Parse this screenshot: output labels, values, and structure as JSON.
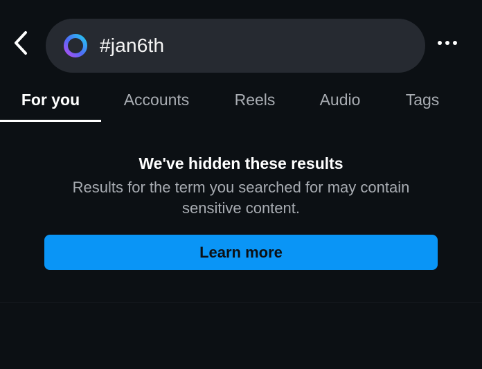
{
  "header": {
    "back_icon": "chevron-left-icon",
    "search": {
      "query": "#jan6th",
      "icon": "meta-ai-ring-icon"
    },
    "more_icon": "more-horizontal-icon"
  },
  "tabs": [
    {
      "label": "For you",
      "active": true
    },
    {
      "label": "Accounts",
      "active": false
    },
    {
      "label": "Reels",
      "active": false
    },
    {
      "label": "Audio",
      "active": false
    },
    {
      "label": "Tags",
      "active": false
    }
  ],
  "notice": {
    "title": "We've hidden these results",
    "body": "Results for the term you searched for may contain sensitive content.",
    "button_label": "Learn more"
  },
  "colors": {
    "background": "#0c1014",
    "search_bar": "#262a31",
    "accent_button": "#0a95f6",
    "muted_text": "#a8acb2"
  }
}
